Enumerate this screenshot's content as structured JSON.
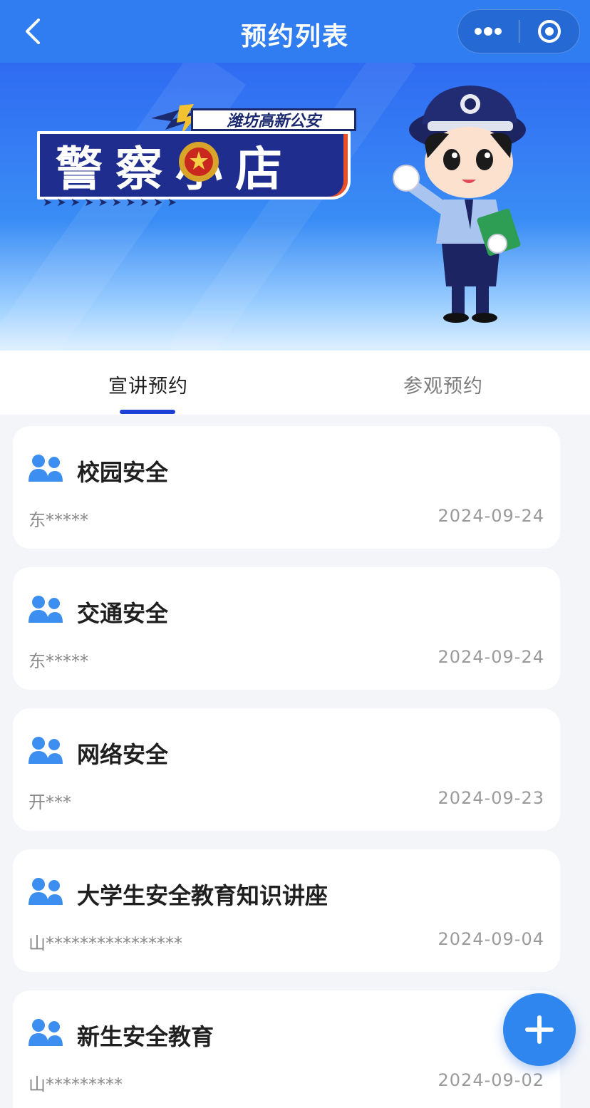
{
  "header": {
    "title": "预约列表",
    "back_icon": "chevron-left-icon",
    "more_icon": "more-dots-icon",
    "close_icon": "target-circle-icon"
  },
  "banner": {
    "tag": "潍坊高新公安",
    "sign": "警察小店",
    "arrows": "➤➤➤➤➤➤➤➤➤➤"
  },
  "tabs": [
    {
      "label": "宣讲预约",
      "active": true
    },
    {
      "label": "参观预约",
      "active": false
    }
  ],
  "cards": [
    {
      "title": "校园安全",
      "user": "东*****",
      "date": "2024-09-24"
    },
    {
      "title": "交通安全",
      "user": "东*****",
      "date": "2024-09-24"
    },
    {
      "title": "网络安全",
      "user": "开***",
      "date": "2024-09-23"
    },
    {
      "title": "大学生安全教育知识讲座",
      "user": "山****************",
      "date": "2024-09-04"
    },
    {
      "title": "新生安全教育",
      "user": "山*********",
      "date": "2024-09-02"
    }
  ],
  "fab": {
    "icon": "plus-icon"
  },
  "colors": {
    "header_bg": "#2f7df0",
    "accent": "#1a40d6",
    "fab": "#2f86ee",
    "icon": "#3c8ff0"
  }
}
